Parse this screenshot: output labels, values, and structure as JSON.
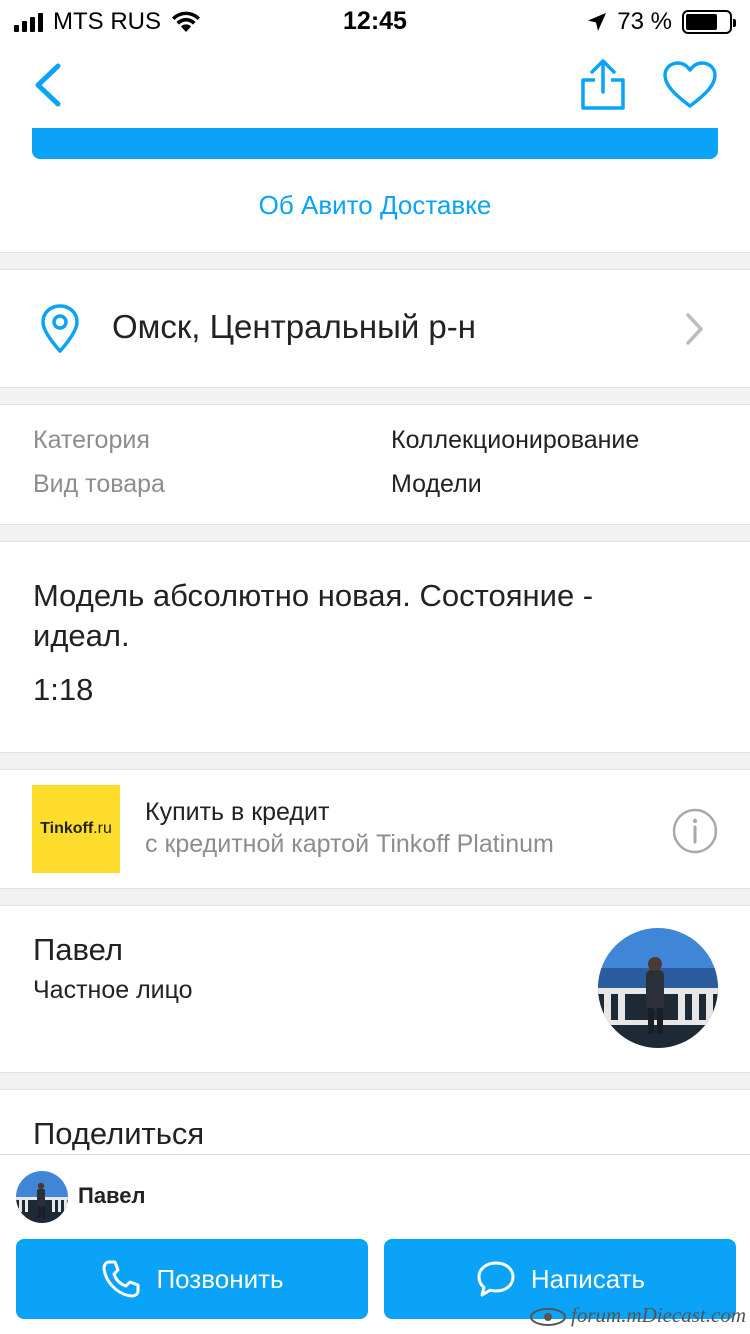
{
  "status_bar": {
    "carrier": "MTS RUS",
    "time": "12:45",
    "battery": "73 %",
    "battery_level": 0.73
  },
  "nav": {
    "icons": [
      "chevron-left-icon",
      "share-icon",
      "heart-icon"
    ]
  },
  "delivery": {
    "link": "Об Авито Доставке"
  },
  "location": {
    "text": "Омск, Центральный р-н"
  },
  "params": [
    {
      "label": "Категория",
      "value": "Коллекционирование"
    },
    {
      "label": "Вид товара",
      "value": "Модели"
    }
  ],
  "description": {
    "text": "Модель абсолютно новая. Состояние - идеал.",
    "scale": "1:18"
  },
  "credit": {
    "logo_text": "Tinkoff",
    "logo_suffix": ".ru",
    "title": "Купить в кредит",
    "subtitle": "с кредитной картой Tinkoff Platinum"
  },
  "seller": {
    "name": "Павел",
    "type": "Частное лицо"
  },
  "share": {
    "title": "Поделиться"
  },
  "bottom_bar": {
    "name": "Павел",
    "call_label": "Позвонить",
    "write_label": "Написать"
  },
  "watermark": "forum.mDiecast.com",
  "colors": {
    "accent": "#0aa3f8",
    "tinkoff_yellow": "#ffdd2d",
    "secondary_text": "#8d8d8d"
  }
}
